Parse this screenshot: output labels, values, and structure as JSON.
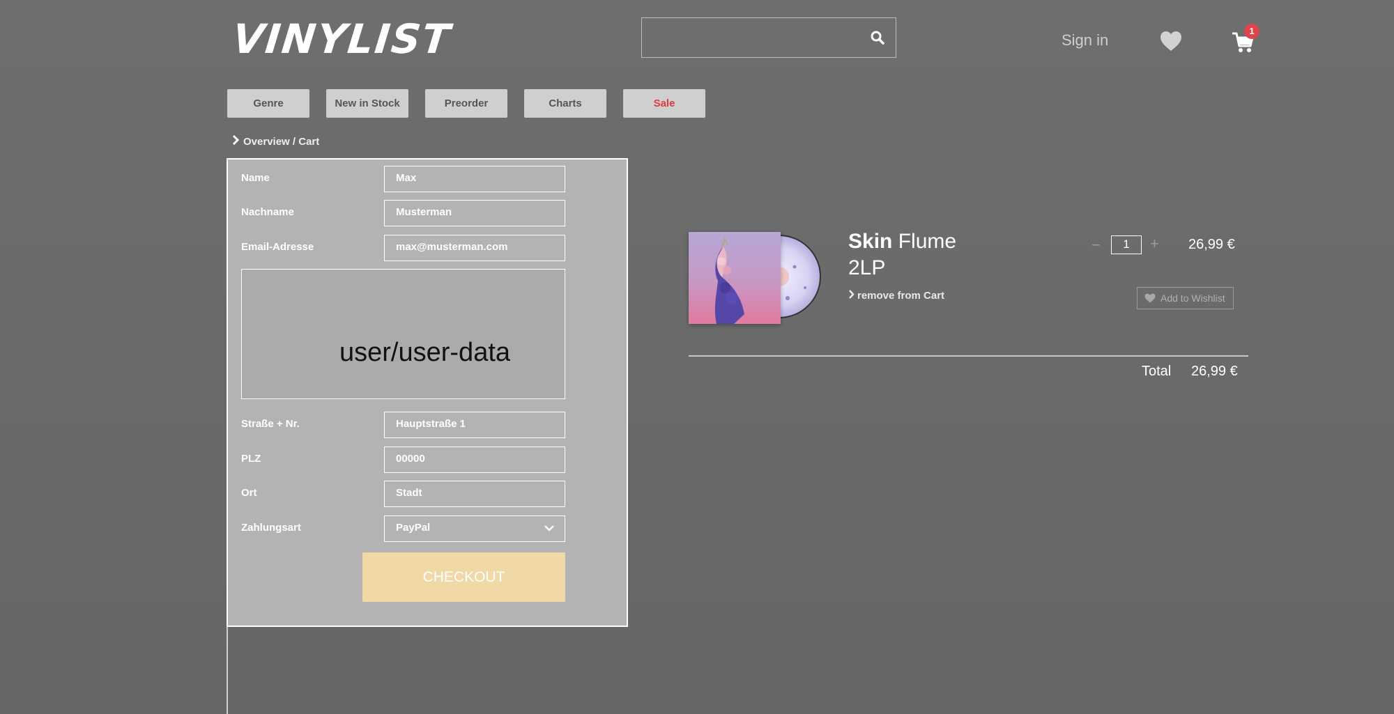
{
  "header": {
    "logo": "VINYLIST",
    "search": {
      "placeholder": "",
      "value": ""
    },
    "sign_in": "Sign in",
    "cart_count": "1"
  },
  "nav": [
    {
      "label": "Genre"
    },
    {
      "label": "New in Stock"
    },
    {
      "label": "Preorder"
    },
    {
      "label": "Charts"
    },
    {
      "label": "Sale"
    }
  ],
  "breadcrumb": "Overview / Cart",
  "form": {
    "name_label": "Name",
    "name_value": "Max",
    "lastname_label": "Nachname",
    "lastname_value": "Musterman",
    "email_label": "Email-Adresse",
    "email_value": "max@musterman.com",
    "user_box": "user/user-data",
    "street_label": "Straße + Nr.",
    "street_value": "Hauptstraße 1",
    "zip_label": "PLZ",
    "zip_value": "00000",
    "city_label": "Ort",
    "city_value": "Stadt",
    "payment_label": "Zahlungsart",
    "payment_value": "PayPal",
    "checkout_label": "CHECKOUT"
  },
  "cart": {
    "item": {
      "title_bold": "Skin",
      "title_rest": "Flume",
      "format": "2LP",
      "remove_label": "remove from Cart",
      "quantity": "1",
      "price": "26,99 €",
      "wishlist_label": "Add to Wishlist"
    },
    "total_label": "Total",
    "total_value": "26,99 €"
  },
  "colors": {
    "accent_sale": "#e23a3a",
    "checkout_bg": "#f0d9a6",
    "badge": "#e0434a"
  }
}
